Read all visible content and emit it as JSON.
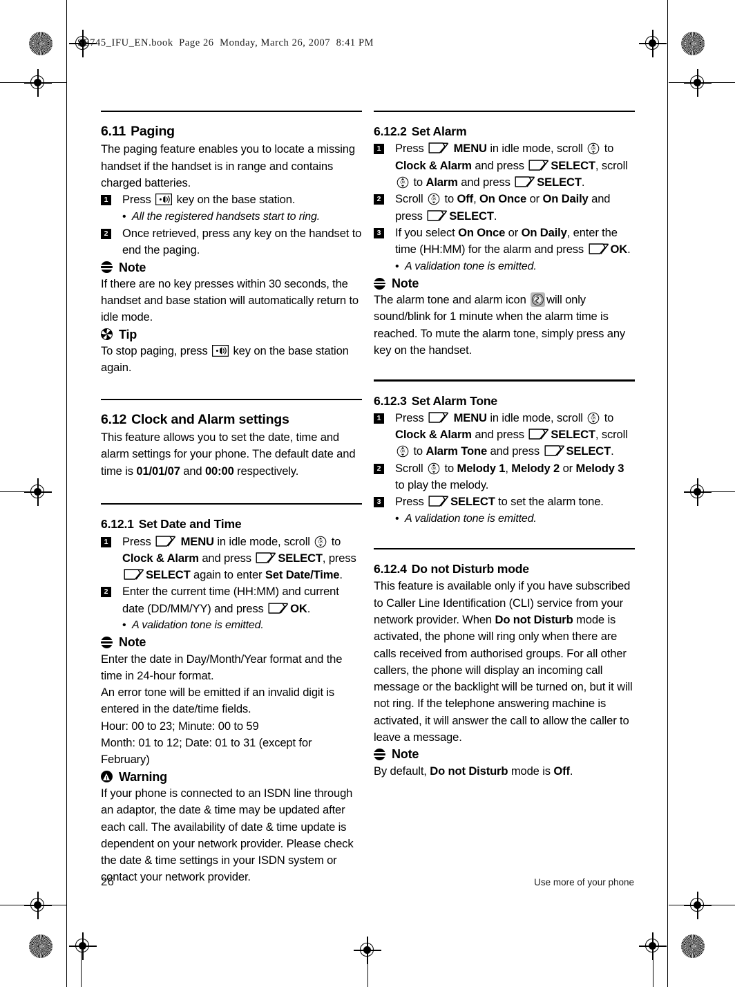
{
  "print_slug": "SE745_IFU_EN.book  Page 26  Monday, March 26, 2007  8:41 PM",
  "footer": {
    "page_number": "26",
    "running_head": "Use more of your phone"
  },
  "icons": {
    "note": "note-icon",
    "tip": "tip-icon",
    "warning": "warning-icon",
    "softkey": "softkey-icon",
    "scroll": "scroll-updown-icon",
    "paging_key": "paging-key-icon",
    "alarm_clock": "alarm-clock-icon"
  },
  "left_column": {
    "section_611": {
      "number": "6.11",
      "title": "Paging",
      "intro": "The paging feature enables you to locate a missing handset if the handset is in range and contains charged batteries.",
      "step1_a": "Press",
      "step1_b": "key on the base station.",
      "step1_bullet": "All the registered handsets start to ring.",
      "step2": "Once retrieved, press any key on the handset to end the paging.",
      "note_label": "Note",
      "note_text": "If there are no key presses within 30 seconds, the handset and base station will automatically return to idle mode.",
      "tip_label": "Tip",
      "tip_a": "To stop paging, press",
      "tip_b": "key on the base station again."
    },
    "section_612": {
      "number": "6.12",
      "title": "Clock and Alarm settings",
      "text_a": "This feature allows you to set the date, time and alarm settings for your phone. The default date and time is",
      "default_date": "01/01/07",
      "text_b": "and",
      "default_time": "00:00",
      "text_c": "respectively."
    },
    "section_6121": {
      "number": "6.12.1",
      "title": "Set Date and Time",
      "s1_t1": "Press",
      "s1_menu": "MENU",
      "s1_t2": "in idle mode, scroll",
      "s1_t3": "to",
      "s1_menuitem": "Clock & Alarm",
      "s1_t4": "and press",
      "s1_select1": "SELECT",
      "s1_t5": ", press",
      "s1_select2": "SELECT",
      "s1_t6": "again to enter",
      "s1_target": "Set Date/Time",
      "s1_t7": ".",
      "s2_t1": "Enter the current time (HH:MM) and current date (DD/MM/YY) and press",
      "s2_ok": "OK",
      "s2_t2": ".",
      "s2_bullet": "A validation tone is emitted.",
      "note_label": "Note",
      "note_l1": "Enter the date in Day/Month/Year format and the time in 24-hour format.",
      "note_l2": "An error tone will be emitted if an invalid digit is entered in the date/time fields.",
      "note_l3": "Hour: 00 to 23; Minute: 00 to 59",
      "note_l4": "Month: 01 to 12; Date: 01 to 31 (except for February)",
      "warning_label": "Warning",
      "warning_text": "If your phone is connected to an ISDN line through an adaptor, the date & time may be updated after each call. The availability of date & time update is dependent on your network provider. Please check the date & time settings in your ISDN system or contact your network provider."
    }
  },
  "right_column": {
    "section_6122": {
      "number": "6.12.2",
      "title": "Set Alarm",
      "s1_t1": "Press",
      "s1_menu": "MENU",
      "s1_t2": "in idle mode, scroll",
      "s1_t3": "to",
      "s1_menuitem": "Clock & Alarm",
      "s1_t4": "and press",
      "s1_select1": "SELECT",
      "s1_t5": ", scroll",
      "s1_t6": "to",
      "s1_menuitem2": "Alarm",
      "s1_t7": "and press",
      "s1_select2": "SELECT",
      "s1_t8": ".",
      "s2_t1": "Scroll",
      "s2_t2": "to",
      "s2_opt1": "Off",
      "s2_sep1": ",",
      "s2_opt2": "On Once",
      "s2_sep2": "or",
      "s2_opt3": "On Daily",
      "s2_t3": "and press",
      "s2_select": "SELECT",
      "s2_t4": ".",
      "s3_t1": "If you select",
      "s3_opt1": "On Once",
      "s3_sep": "or",
      "s3_opt2": "On Daily",
      "s3_t2": ", enter the time (HH:MM) for the alarm and press",
      "s3_ok": "OK",
      "s3_t3": ".",
      "s3_bullet": "A validation tone is emitted.",
      "note_label": "Note",
      "note_a": "The alarm tone and alarm icon",
      "note_b": "will only sound/blink for 1 minute when the alarm time is reached. To mute the alarm tone, simply press any key on the handset."
    },
    "section_6123": {
      "number": "6.12.3",
      "title": "Set Alarm Tone",
      "s1_t1": "Press",
      "s1_menu": "MENU",
      "s1_t2": "in idle mode, scroll",
      "s1_t3": "to",
      "s1_menuitem": "Clock & Alarm",
      "s1_t4": "and press",
      "s1_select1": "SELECT",
      "s1_t5": ", scroll",
      "s1_t6": "to",
      "s1_menuitem2": "Alarm Tone",
      "s1_t7": "and press",
      "s1_select2": "SELECT",
      "s1_t8": ".",
      "s2_t1": "Scroll",
      "s2_t2": "to",
      "s2_opt1": "Melody 1",
      "s2_sep1": ",",
      "s2_opt2": "Melody 2",
      "s2_sep2": "or",
      "s2_opt3": "Melody 3",
      "s2_t3": "to play the melody.",
      "s3_t1": "Press",
      "s3_select": "SELECT",
      "s3_t2": "to set the alarm tone.",
      "s3_bullet": "A validation tone is emitted."
    },
    "section_6124": {
      "number": "6.12.4",
      "title": "Do not Disturb mode",
      "p_a": "This feature is available only if you have subscribed to Caller Line Identification (CLI) service from your network provider. When",
      "p_b": "Do not Disturb",
      "p_c": "mode is activated, the phone will ring only when there are calls received from authorised groups. For all other callers, the phone will display an incoming call message or the backlight will be turned on, but it will not ring. If the telephone answering machine is activated, it will answer the call to allow the caller to leave a message.",
      "note_label": "Note",
      "note_a": "By default,",
      "note_b": "Do not Disturb",
      "note_c": "mode is",
      "note_d": "Off",
      "note_e": "."
    }
  }
}
